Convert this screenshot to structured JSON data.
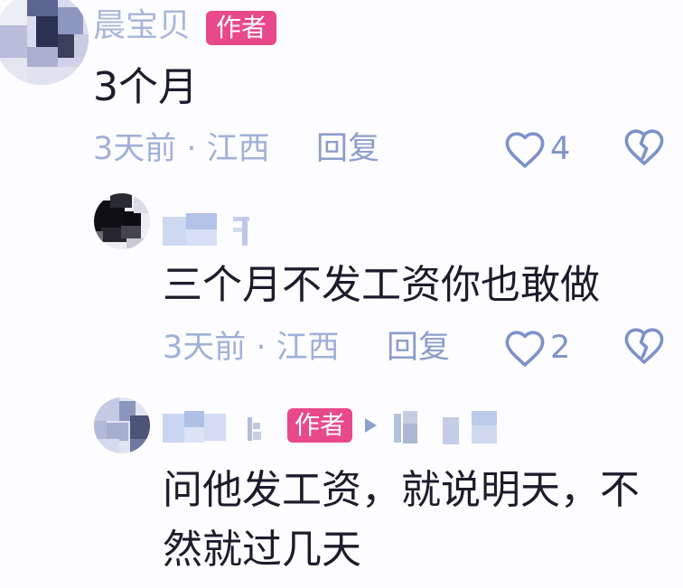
{
  "comment": {
    "username": "晨宝贝",
    "author_badge": "作者",
    "text": "3个月",
    "time_location": "3天前 · 江西",
    "reply_label": "回复",
    "like_count": 4,
    "replies": [
      {
        "text": "三个月不发工资你也敢做",
        "time_location": "3天前 · 江西",
        "reply_label": "回复",
        "like_count": 2
      },
      {
        "author_badge": "作者",
        "text": "问他发工资，就说明天，不然就过几天"
      }
    ]
  },
  "icons": {
    "like": "heart-outline-icon",
    "dislike": "broken-heart-icon",
    "reply_to": "triangle-right-icon"
  },
  "colors": {
    "background": "#fdfdff",
    "text": "#1c1c2c",
    "username": "#a9b7da",
    "meta": "#a0b0d8",
    "reply": "#8c9dcb",
    "icon": "#7d92c9",
    "icon_light": "#8fa0cc",
    "author_badge": "#e8498a",
    "author_badge_text": "#ffffff"
  }
}
